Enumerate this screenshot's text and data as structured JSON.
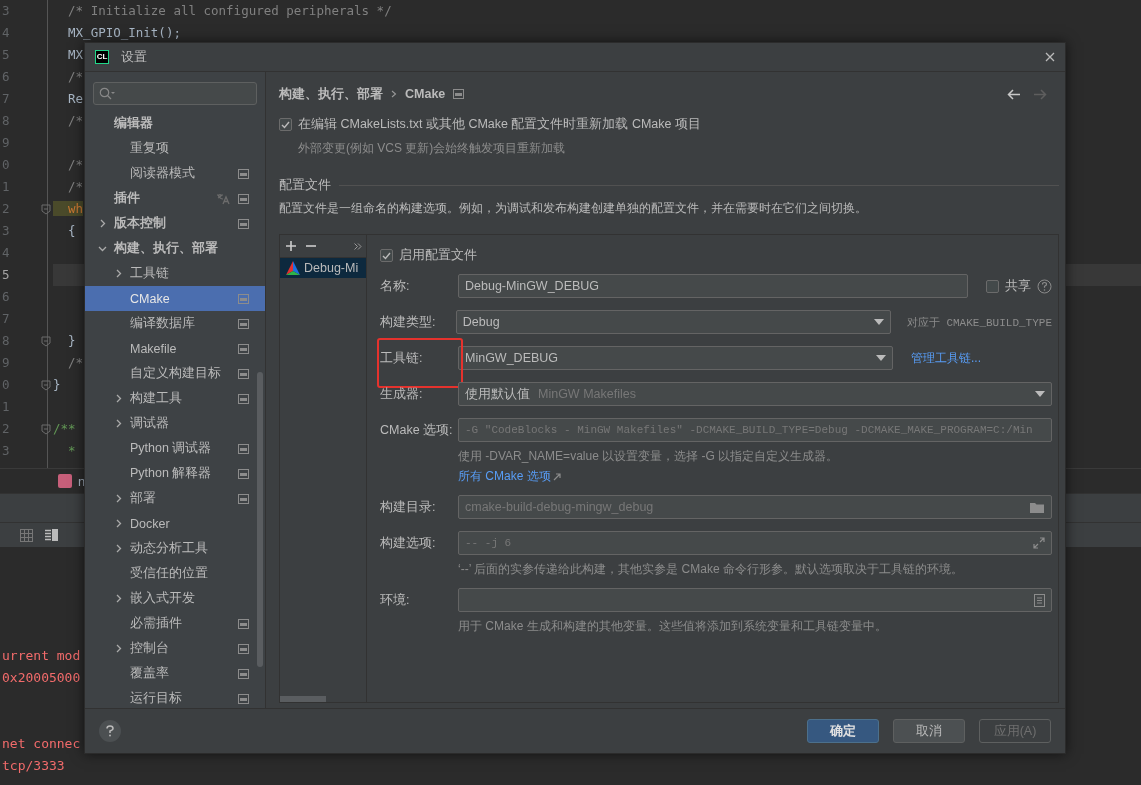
{
  "editor": {
    "lines": [
      {
        "number": "3",
        "text": "  /* Initialize all configured peripherals */",
        "kind": "comment",
        "fold": false,
        "current": false
      },
      {
        "number": "4",
        "text": "  MX_GPIO_Init();",
        "kind": "code",
        "fold": false,
        "current": false
      },
      {
        "number": "5",
        "text": "  MX",
        "kind": "code",
        "fold": false,
        "current": false
      },
      {
        "number": "6",
        "text": "  /*",
        "kind": "comment",
        "fold": false,
        "current": false
      },
      {
        "number": "7",
        "text": "  Re",
        "kind": "code",
        "fold": false,
        "current": false
      },
      {
        "number": "8",
        "text": "  /*",
        "kind": "comment",
        "fold": false,
        "current": false
      },
      {
        "number": "9",
        "fold": false,
        "current": false
      },
      {
        "number": "0",
        "text": "  /*",
        "kind": "comment",
        "fold": false,
        "current": false
      },
      {
        "number": "1",
        "text": "  /*",
        "kind": "comment",
        "fold": false,
        "current": false
      },
      {
        "number": "2",
        "text": "  wh",
        "kind": "keyword",
        "fold": true,
        "current": false
      },
      {
        "number": "3",
        "text": "  {",
        "kind": "code",
        "fold": false,
        "current": false
      },
      {
        "number": "4",
        "fold": false,
        "current": false
      },
      {
        "number": "5",
        "fold": false,
        "current": true
      },
      {
        "number": "6",
        "fold": false,
        "current": false
      },
      {
        "number": "7",
        "fold": false,
        "current": false
      },
      {
        "number": "8",
        "text": "  }",
        "kind": "code",
        "fold": true,
        "current": false
      },
      {
        "number": "9",
        "text": "  /*",
        "kind": "comment",
        "fold": false,
        "current": false
      },
      {
        "number": "0",
        "text": "}",
        "kind": "code",
        "fold": true,
        "current": false
      },
      {
        "number": "1",
        "fold": false,
        "current": false
      },
      {
        "number": "2",
        "text": "/**",
        "kind": "doc",
        "fold": true,
        "current": false
      },
      {
        "number": "3",
        "text": "  *",
        "kind": "doc",
        "fold": false,
        "current": false
      }
    ]
  },
  "editor_tab": {
    "label": "n"
  },
  "console": {
    "blocks": [
      [
        "urrent mod",
        "0x20005000"
      ],
      [
        "net connec",
        "tcp/3333"
      ]
    ]
  },
  "dialog": {
    "logo_text": "CL",
    "title": "设置",
    "sidebar": {
      "items": [
        {
          "label": "编辑器",
          "expandable": false,
          "selected": false,
          "project_level": false,
          "language_icon": false,
          "children": [
            {
              "label": "重复项",
              "expandable": false,
              "selected": false,
              "project_level": false,
              "language_icon": false
            },
            {
              "label": "阅读器模式",
              "expandable": false,
              "selected": false,
              "project_level": true,
              "language_icon": false
            }
          ]
        },
        {
          "label": "插件",
          "expandable": false,
          "selected": false,
          "project_level": true,
          "language_icon": true
        },
        {
          "label": "版本控制",
          "expandable": true,
          "expanded": false,
          "selected": false,
          "project_level": true,
          "language_icon": false
        },
        {
          "label": "构建、执行、部署",
          "expandable": true,
          "expanded": true,
          "selected": false,
          "project_level": false,
          "language_icon": false,
          "children": [
            {
              "label": "工具链",
              "expandable": true,
              "expanded": false,
              "selected": false,
              "project_level": false,
              "language_icon": false
            },
            {
              "label": "CMake",
              "expandable": false,
              "selected": true,
              "project_level": true,
              "language_icon": false
            },
            {
              "label": "编译数据库",
              "expandable": false,
              "selected": false,
              "project_level": true,
              "language_icon": false
            },
            {
              "label": "Makefile",
              "expandable": false,
              "selected": false,
              "project_level": true,
              "language_icon": false
            },
            {
              "label": "自定义构建目标",
              "expandable": false,
              "selected": false,
              "project_level": true,
              "language_icon": false
            },
            {
              "label": "构建工具",
              "expandable": true,
              "expanded": false,
              "selected": false,
              "project_level": true,
              "language_icon": false
            },
            {
              "label": "调试器",
              "expandable": true,
              "expanded": false,
              "selected": false,
              "project_level": false,
              "language_icon": false
            },
            {
              "label": "Python 调试器",
              "expandable": false,
              "selected": false,
              "project_level": true,
              "language_icon": false
            },
            {
              "label": "Python 解释器",
              "expandable": false,
              "selected": false,
              "project_level": true,
              "language_icon": false
            },
            {
              "label": "部署",
              "expandable": true,
              "expanded": false,
              "selected": false,
              "project_level": true,
              "language_icon": false
            },
            {
              "label": "Docker",
              "expandable": true,
              "expanded": false,
              "selected": false,
              "project_level": false,
              "language_icon": false
            },
            {
              "label": "动态分析工具",
              "expandable": true,
              "expanded": false,
              "selected": false,
              "project_level": false,
              "language_icon": false
            },
            {
              "label": "受信任的位置",
              "expandable": false,
              "selected": false,
              "project_level": false,
              "language_icon": false
            },
            {
              "label": "嵌入式开发",
              "expandable": true,
              "expanded": false,
              "selected": false,
              "project_level": false,
              "language_icon": false
            },
            {
              "label": "必需插件",
              "expandable": false,
              "selected": false,
              "project_level": true,
              "language_icon": false
            },
            {
              "label": "控制台",
              "expandable": true,
              "expanded": false,
              "selected": false,
              "project_level": true,
              "language_icon": false
            },
            {
              "label": "覆盖率",
              "expandable": false,
              "selected": false,
              "project_level": true,
              "language_icon": false
            },
            {
              "label": "运行目标",
              "expandable": false,
              "selected": false,
              "project_level": true,
              "language_icon": false
            }
          ]
        }
      ]
    },
    "breadcrumb": [
      "构建、执行、部署",
      "CMake"
    ],
    "navigation": {
      "back_enabled": true,
      "forward_enabled": false
    },
    "reload_option": {
      "label": "在编辑 CMakeLists.txt 或其他 CMake 配置文件时重新加载 CMake 项目",
      "checked": true,
      "hint": "外部变更(例如 VCS 更新)会始终触发项目重新加载"
    },
    "section": {
      "title": "配置文件",
      "description": "配置文件是一组命名的构建选项。例如，为调试和发布构建创建单独的配置文件，并在需要时在它们之间切换。"
    },
    "profiles": [
      {
        "label": "Debug-Mi",
        "selected": true
      }
    ],
    "profile_form": {
      "enable": {
        "label": "启用配置文件",
        "checked": true
      },
      "rows": [
        {
          "kind": "text",
          "label": "名称:",
          "value": "Debug-MinGW_DEBUG",
          "highlighted": false,
          "share": {
            "label": "共享",
            "checked": false
          }
        },
        {
          "kind": "dropdown",
          "label": "构建类型:",
          "value": "Debug",
          "highlighted": false,
          "note": "对应于 CMAKE_BUILD_TYPE"
        },
        {
          "kind": "dropdown",
          "label": "工具链:",
          "value": "MinGW_DEBUG",
          "highlighted": true,
          "link": "管理工具链..."
        },
        {
          "kind": "dropdown",
          "label": "生成器:",
          "value": "使用默认值",
          "value_hint": "MinGW Makefiles",
          "highlighted": false
        },
        {
          "kind": "code",
          "label": "CMake 选项:",
          "placeholder": "-G \"CodeBlocks - MinGW Makefiles\" -DCMAKE_BUILD_TYPE=Debug -DCMAKE_MAKE_PROGRAM=C:/Min",
          "highlighted": false,
          "hint": "使用 -DVAR_NAME=value 以设置变量，选择 -G 以指定自定义生成器。",
          "hint_link": "所有 CMake 选项"
        },
        {
          "kind": "text",
          "label": "构建目录:",
          "placeholder": "cmake-build-debug-mingw_debug",
          "highlighted": false,
          "button": {
            "kind": "folder"
          }
        },
        {
          "kind": "code",
          "label": "构建选项:",
          "placeholder": "-- -j 6",
          "highlighted": false,
          "button": {
            "kind": "expand"
          },
          "hint": "‘--’ 后面的实参传递给此构建，其他实参是 CMake 命令行形参。默认选项取决于工具链的环境。"
        },
        {
          "kind": "text",
          "label": "环境:",
          "highlighted": false,
          "button": {
            "kind": "document"
          },
          "hint": "用于 CMake 生成和构建的其他变量。这些值将添加到系统变量和工具链变量中。"
        }
      ]
    },
    "buttons": [
      {
        "label": "确定",
        "kind": "primary",
        "disabled": false
      },
      {
        "label": "取消",
        "kind": "normal",
        "disabled": false
      },
      {
        "label": "应用(A)",
        "kind": "normal",
        "disabled": true
      }
    ]
  }
}
